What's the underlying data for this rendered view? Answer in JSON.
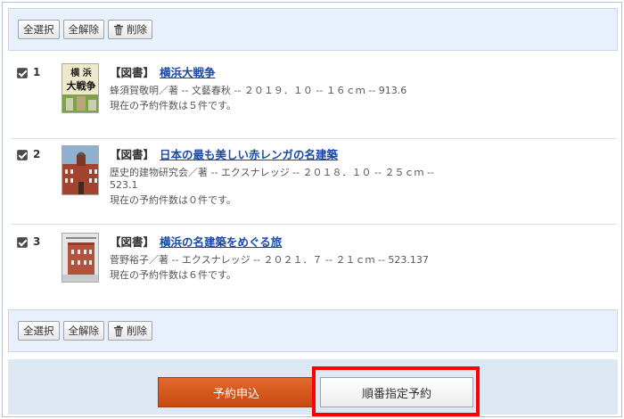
{
  "toolbar_top": {
    "select_all": "全選択",
    "deselect_all": "全解除",
    "delete": "削除"
  },
  "toolbar_bottom": {
    "select_all": "全選択",
    "deselect_all": "全解除",
    "delete": "削除"
  },
  "items": [
    {
      "number": "1",
      "kind": "【図書】",
      "title": "横浜大戦争",
      "meta": "蜂須賀敬明／著 -- 文藝春秋 -- ２０１９．１０ -- １６ｃｍ -- 913.6",
      "reserve": "現在の予約件数は５件です。",
      "cover_text": "横浜大戦争"
    },
    {
      "number": "2",
      "kind": "【図書】",
      "title": "日本の最も美しい赤レンガの名建築",
      "meta": "歴史的建物研究会／著 -- エクスナレッジ -- ２０１８．１０ -- ２５ｃｍ -- 523.1",
      "reserve": "現在の予約件数は０件です。"
    },
    {
      "number": "3",
      "kind": "【図書】",
      "title": "横浜の名建築をめぐる旅",
      "meta": "菅野裕子／著 -- エクスナレッジ -- ２０２１．７ -- ２１ｃｍ -- 523.137",
      "reserve": "現在の予約件数は６件です。"
    }
  ],
  "footer": {
    "apply_label": "予約申込",
    "order_label": "順番指定予約"
  },
  "colors": {
    "accent": "#d0561a",
    "link": "#1a4aa8",
    "highlight": "#ff0000",
    "toolbar_bg": "#e8f0fb"
  }
}
